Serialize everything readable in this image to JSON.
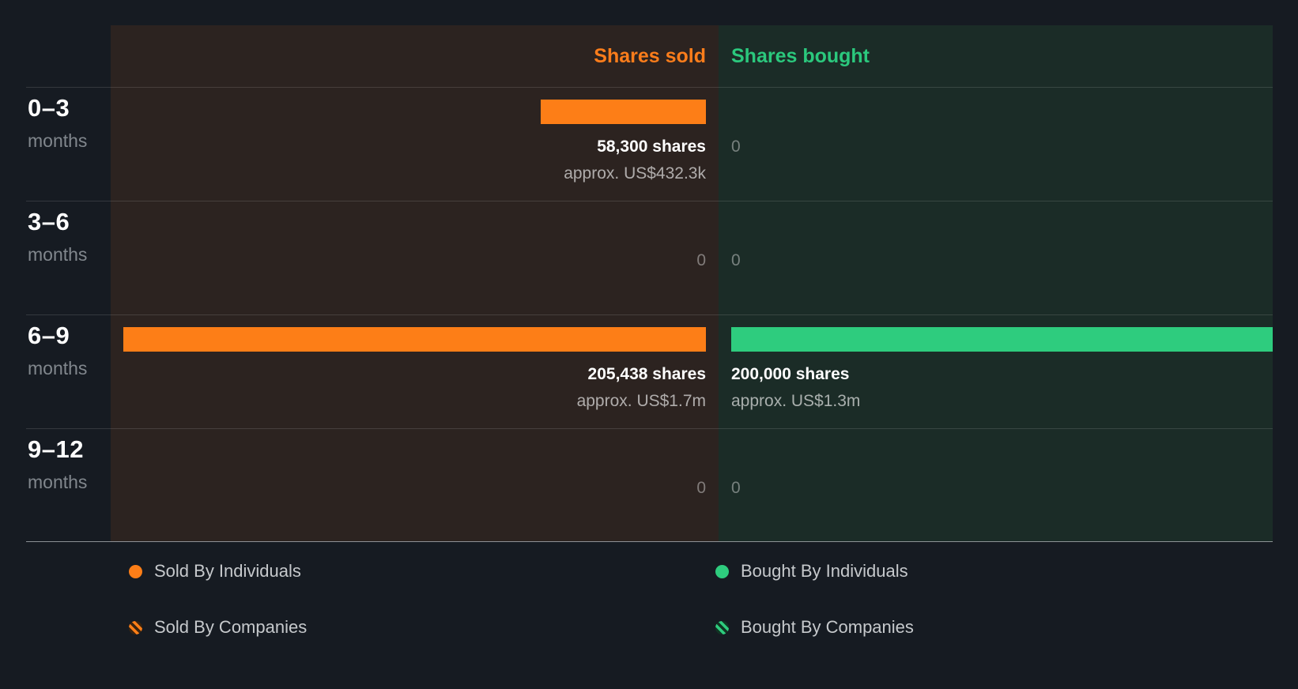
{
  "chart_data": {
    "type": "bar",
    "orientation": "horizontal",
    "categories": [
      "0–3 months",
      "3–6 months",
      "6–9 months",
      "9–12 months"
    ],
    "series": [
      {
        "name": "Shares sold",
        "color": "#fd7e17",
        "values": [
          58300,
          0,
          205438,
          0
        ],
        "value_labels": [
          "58,300 shares",
          "0",
          "205,438 shares",
          "0"
        ],
        "approx_labels": [
          "approx. US$432.3k",
          "",
          "approx. US$1.7m",
          ""
        ]
      },
      {
        "name": "Shares bought",
        "color": "#2ecc7e",
        "values": [
          0,
          0,
          200000,
          0
        ],
        "value_labels": [
          "0",
          "0",
          "200,000 shares",
          "0"
        ],
        "approx_labels": [
          "",
          "",
          "approx. US$1.3m",
          ""
        ]
      }
    ],
    "legend_position": "bottom",
    "legend": [
      "Sold By Individuals",
      "Sold By Companies",
      "Bought By Individuals",
      "Bought By Companies"
    ],
    "grid": false
  },
  "header": {
    "sold_label": "Shares sold",
    "bought_label": "Shares bought"
  },
  "rows": [
    {
      "period": "0–3",
      "unit": "months",
      "sold": {
        "shares": "58,300 shares",
        "approx": "approx. US$432.3k"
      },
      "bought": {
        "shares": "0",
        "approx": ""
      }
    },
    {
      "period": "3–6",
      "unit": "months",
      "sold": {
        "shares": "0",
        "approx": ""
      },
      "bought": {
        "shares": "0",
        "approx": ""
      }
    },
    {
      "period": "6–9",
      "unit": "months",
      "sold": {
        "shares": "205,438 shares",
        "approx": "approx. US$1.7m"
      },
      "bought": {
        "shares": "200,000 shares",
        "approx": "approx. US$1.3m"
      }
    },
    {
      "period": "9–12",
      "unit": "months",
      "sold": {
        "shares": "0",
        "approx": ""
      },
      "bought": {
        "shares": "0",
        "approx": ""
      }
    }
  ],
  "legend": {
    "items": [
      {
        "label": "Sold By Individuals",
        "swatch": "solid-orange",
        "color": "#fd7e17"
      },
      {
        "label": "Sold By Companies",
        "swatch": "striped-orange",
        "color": "#fd7e17"
      },
      {
        "label": "Bought By Individuals",
        "swatch": "solid-green",
        "color": "#2ecc7e"
      },
      {
        "label": "Bought By Companies",
        "swatch": "striped-green",
        "color": "#2ecc7e"
      }
    ]
  },
  "colors": {
    "background": "#161b22",
    "sold_panel": "#2c2320",
    "bought_panel": "#1b2c27",
    "sold_accent": "#fd7e17",
    "bought_accent": "#2ecc7e"
  }
}
